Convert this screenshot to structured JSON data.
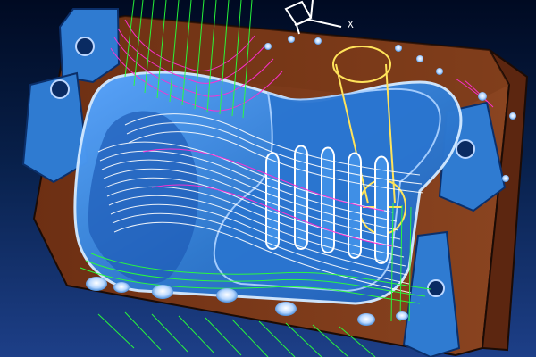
{
  "viewport": {
    "axis_x_label": "X",
    "background_top": "#000a22",
    "background_bottom": "#1d3f88"
  },
  "colors": {
    "mold_side": "#7a3a1a",
    "mold_top": "#2f7bd1",
    "cavity_surface": "#3f8fe6",
    "toolpath_green": "#29ff3a",
    "toolpath_magenta": "#ff2fd2",
    "toolpath_white": "#ffffff",
    "guide_yellow": "#ffe35a"
  },
  "icons": {
    "triad": "axis-triad-icon"
  }
}
